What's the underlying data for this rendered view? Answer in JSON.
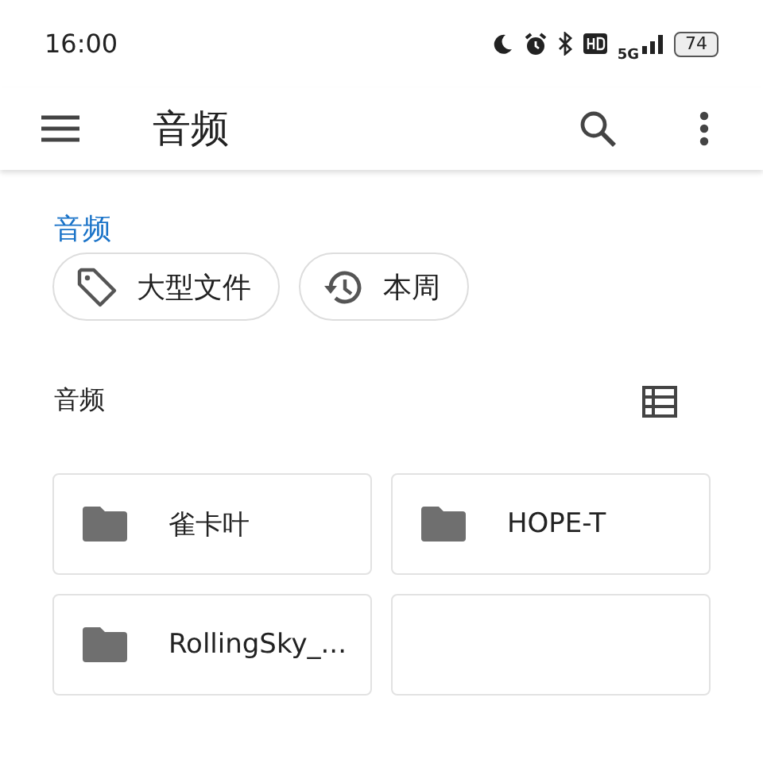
{
  "status_bar": {
    "time": "16:00",
    "network": "5G",
    "battery": "74"
  },
  "toolbar": {
    "title": "音频"
  },
  "breadcrumb": "音频",
  "chips": [
    {
      "kind": "tag",
      "label": "大型文件"
    },
    {
      "kind": "history",
      "label": "本周"
    }
  ],
  "section": {
    "title": "音频"
  },
  "folders": [
    {
      "kind": "folder",
      "name": "雀卡叶"
    },
    {
      "kind": "folder",
      "name": "HOPE-T"
    },
    {
      "kind": "folder",
      "name": "RollingSky_..."
    },
    {
      "kind": "blank"
    }
  ]
}
